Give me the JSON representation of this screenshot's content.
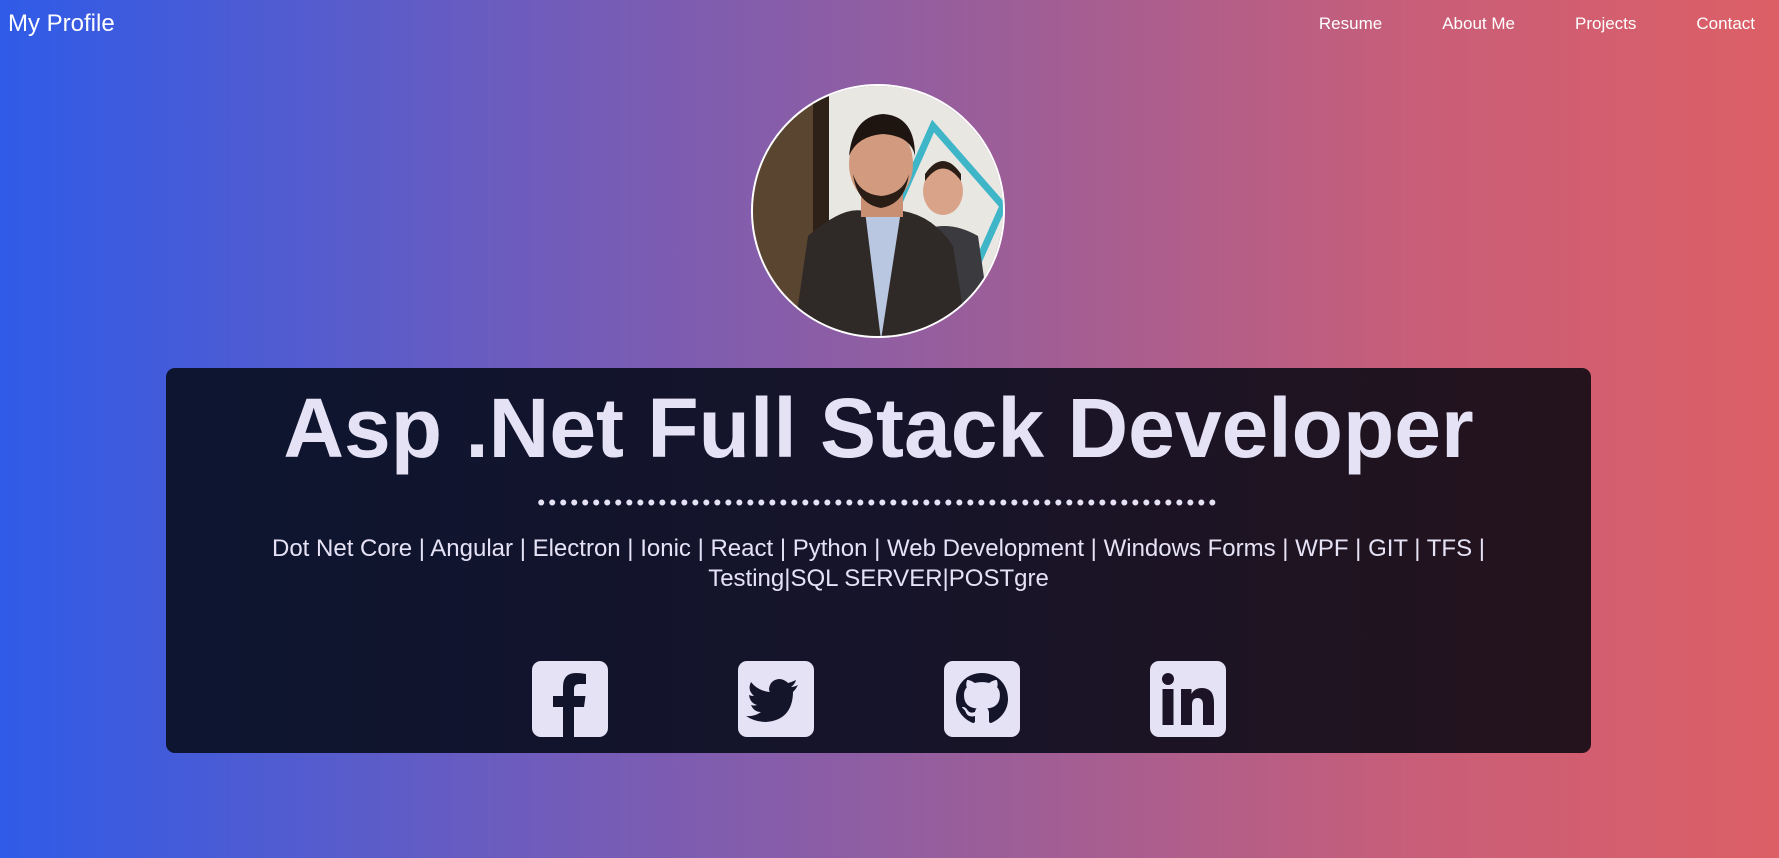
{
  "nav": {
    "brand": "My Profile",
    "links": [
      "Resume",
      "About Me",
      "Projects",
      "Contact"
    ]
  },
  "hero": {
    "title": "Asp .Net Full Stack Developer",
    "dots": "••••••••••••••••••••••••••••••••••••••••••••••••••••••••••••••",
    "skills": "Dot Net Core | Angular | Electron | Ionic | React | Python | Web Development | Windows Forms | WPF | GIT | TFS | Testing|SQL SERVER|POSTgre"
  },
  "socials": [
    {
      "icon": "facebook-icon"
    },
    {
      "icon": "twitter-icon"
    },
    {
      "icon": "github-icon"
    },
    {
      "icon": "linkedin-icon"
    }
  ],
  "colors": {
    "card_text": "#e6e2f6",
    "gradient_left": "#2f5be8",
    "gradient_right": "#dc5f66"
  }
}
